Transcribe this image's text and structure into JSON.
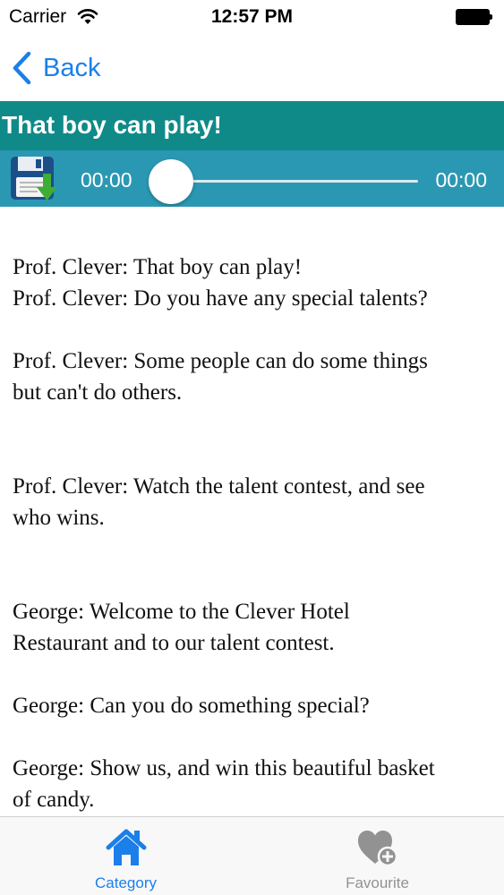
{
  "status_bar": {
    "carrier": "Carrier",
    "time": "12:57 PM",
    "icons": [
      "wifi-icon",
      "battery-icon"
    ]
  },
  "nav": {
    "back_label": "Back",
    "back_icon": "chevron-left-icon"
  },
  "title": "That boy can play!",
  "player": {
    "elapsed": "00:00",
    "total": "00:00",
    "progress": 0,
    "save_icon": "floppy-download-icon"
  },
  "dialogue": {
    "lines": [
      "Prof. Clever: That boy can play!",
      "Prof. Clever: Do you have any special talents?",
      "",
      "Prof. Clever: Some people can do some things",
      "but can't do others.",
      "",
      "",
      "Prof. Clever: Watch the talent contest, and see",
      "who wins.",
      "",
      "",
      "George: Welcome to the Clever Hotel",
      "Restaurant and to our talent contest.",
      "",
      "George: Can you do something special?",
      "",
      "George: Show us, and win this beautiful basket",
      "of candy."
    ]
  },
  "tabs": [
    {
      "label": "Category",
      "icon": "home-icon",
      "active": true
    },
    {
      "label": "Favourite",
      "icon": "heart-add-icon",
      "active": false
    }
  ],
  "colors": {
    "accent": "#1b7fea",
    "title_bar": "#0f8a88",
    "player_bar": "#2b98b3",
    "inactive_tab": "#929292"
  }
}
